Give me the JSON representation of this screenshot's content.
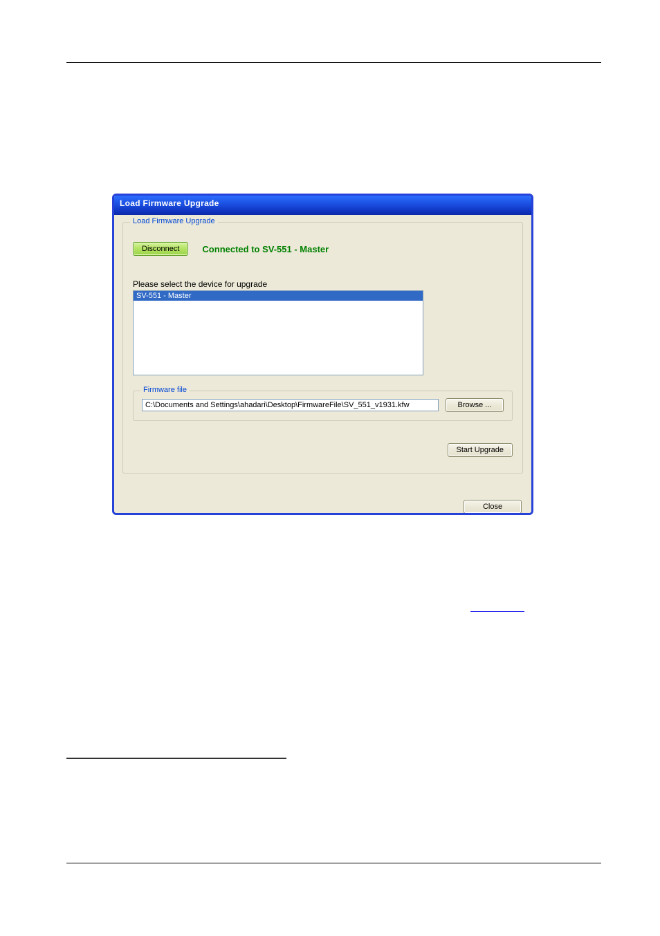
{
  "dialog": {
    "title": "Load Firmware Upgrade",
    "group_label": "Load Firmware Upgrade",
    "disconnect_label": "Disconnect",
    "status": "Connected to SV-551 - Master",
    "select_label": "Please select the device for upgrade",
    "devices": [
      "SV-551 - Master"
    ],
    "firmware_group_label": "Firmware file",
    "firmware_path": "C:\\Documents and Settings\\ahadari\\Desktop\\FirmwareFile\\SV_551_v1931.kfw",
    "browse_label": "Browse ...",
    "start_upgrade_label": "Start Upgrade",
    "close_label": "Close"
  }
}
